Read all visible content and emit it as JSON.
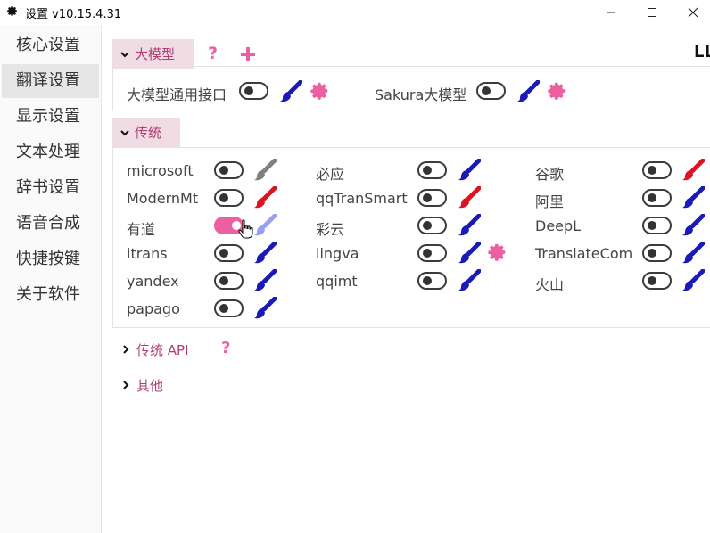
{
  "window": {
    "title": "设置 v10.15.4.31",
    "minimize_icon": "minimize-icon",
    "maximize_icon": "maximize-icon",
    "close_icon": "close-icon"
  },
  "sidebar": {
    "items": [
      {
        "label": "核心设置",
        "active": false
      },
      {
        "label": "翻译设置",
        "active": true
      },
      {
        "label": "显示设置",
        "active": false
      },
      {
        "label": "文本处理",
        "active": false
      },
      {
        "label": "辞书设置",
        "active": false
      },
      {
        "label": "语音合成",
        "active": false
      },
      {
        "label": "快捷按键",
        "active": false
      },
      {
        "label": "关于软件",
        "active": false
      }
    ]
  },
  "llm_section": {
    "tab_label": "大模型",
    "help": "?",
    "truncated_right_text": "LL",
    "items": [
      {
        "label": "大模型通用接口",
        "enabled": false,
        "brush_color": "#1a1ab8",
        "has_gear": true
      },
      {
        "label": "Sakura大模型",
        "enabled": false,
        "brush_color": "#1a1ab8",
        "has_gear": true
      }
    ]
  },
  "traditional_section": {
    "tab_label": "传统",
    "columns": [
      [
        {
          "label": "microsoft",
          "enabled": false,
          "brush_color": "#808080"
        },
        {
          "label": "ModernMt",
          "enabled": false,
          "brush_color": "#e01020"
        },
        {
          "label": "有道",
          "enabled": true,
          "brush_color": "#9aa0f0"
        },
        {
          "label": "itrans",
          "enabled": false,
          "brush_color": "#1a1ab8"
        },
        {
          "label": "yandex",
          "enabled": false,
          "brush_color": "#1a1ab8"
        },
        {
          "label": "papago",
          "enabled": false,
          "brush_color": "#1a1ab8"
        }
      ],
      [
        {
          "label": "必应",
          "enabled": false,
          "brush_color": "#1a1ab8"
        },
        {
          "label": "qqTranSmart",
          "enabled": false,
          "brush_color": "#e01020"
        },
        {
          "label": "彩云",
          "enabled": false,
          "brush_color": "#1a1ab8"
        },
        {
          "label": "lingva",
          "enabled": false,
          "brush_color": "#1a1ab8",
          "has_gear": true
        },
        {
          "label": "qqimt",
          "enabled": false,
          "brush_color": "#1a1ab8"
        }
      ],
      [
        {
          "label": "谷歌",
          "enabled": false,
          "brush_color": "#e01020"
        },
        {
          "label": "阿里",
          "enabled": false,
          "brush_color": "#1a1ab8"
        },
        {
          "label": "DeepL",
          "enabled": false,
          "brush_color": "#1a1ab8"
        },
        {
          "label": "TranslateCom",
          "enabled": false,
          "brush_color": "#1a1ab8"
        },
        {
          "label": "火山",
          "enabled": false,
          "brush_color": "#1a1ab8"
        }
      ]
    ]
  },
  "collapsed_sections": [
    {
      "label": "传统 API",
      "has_help": true,
      "help": "?"
    },
    {
      "label": "其他",
      "has_help": false
    }
  ],
  "colors": {
    "accent": "#ec5fa0",
    "section_text": "#b23c73",
    "tab_bg": "#f0dde4"
  }
}
